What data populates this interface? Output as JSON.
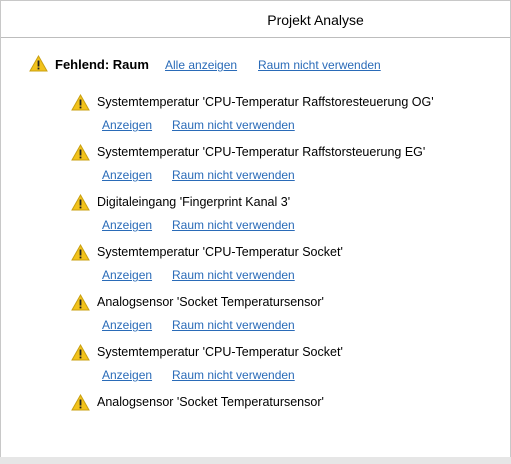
{
  "window": {
    "title": "Projekt Analyse"
  },
  "group": {
    "title": "Fehlend: Raum",
    "show_all_label": "Alle anzeigen",
    "unused_label": "Raum nicht verwenden"
  },
  "items": [
    {
      "label": "Systemtemperatur 'CPU-Temperatur Raffstoresteuerung OG'",
      "show": "Anzeigen",
      "unused": "Raum nicht verwenden"
    },
    {
      "label": "Systemtemperatur 'CPU-Temperatur Raffstorsteuerung EG'",
      "show": "Anzeigen",
      "unused": "Raum nicht verwenden"
    },
    {
      "label": "Digitaleingang 'Fingerprint Kanal 3'",
      "show": "Anzeigen",
      "unused": "Raum nicht verwenden"
    },
    {
      "label": "Systemtemperatur 'CPU-Temperatur Socket'",
      "show": "Anzeigen",
      "unused": "Raum nicht verwenden"
    },
    {
      "label": "Analogsensor 'Socket Temperatursensor'",
      "show": "Anzeigen",
      "unused": "Raum nicht verwenden"
    },
    {
      "label": "Systemtemperatur 'CPU-Temperatur Socket'",
      "show": "Anzeigen",
      "unused": "Raum nicht verwenden"
    },
    {
      "label": "Analogsensor 'Socket Temperatursensor'",
      "show": "",
      "unused": ""
    }
  ],
  "icons": {
    "warning": "warning-triangle-icon"
  },
  "colors": {
    "link": "#2a6bb8",
    "warning": "#f2c21b"
  }
}
